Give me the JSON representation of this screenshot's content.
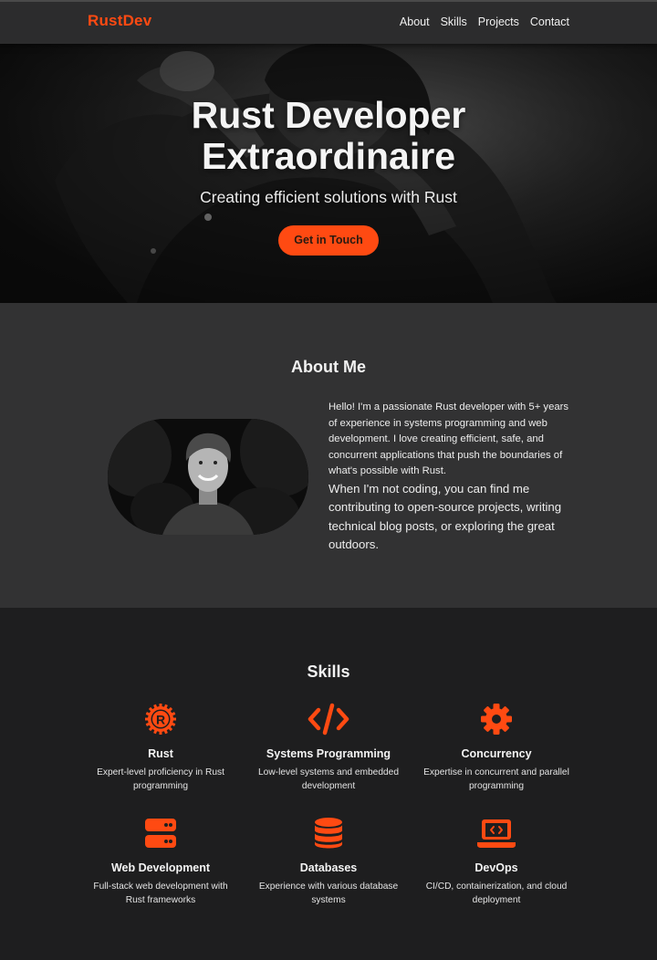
{
  "nav": {
    "brand": "RustDev",
    "links": [
      "About",
      "Skills",
      "Projects",
      "Contact"
    ]
  },
  "hero": {
    "title": "Rust Developer Extraordinaire",
    "subtitle": "Creating efficient solutions with Rust",
    "cta_label": "Get in Touch"
  },
  "about": {
    "title": "About Me",
    "paragraph1": "Hello! I'm a passionate Rust developer with 5+ years of experience in systems programming and web development. I love creating efficient, safe, and concurrent applications that push the boundaries of what's possible with Rust.",
    "paragraph2": "When I'm not coding, you can find me contributing to open-source projects, writing technical blog posts, or exploring the great outdoors."
  },
  "skills": {
    "title": "Skills",
    "items": [
      {
        "name": "Rust",
        "description": "Expert-level proficiency in Rust programming",
        "icon": "rust-logo-icon"
      },
      {
        "name": "Systems Programming",
        "description": "Low-level systems and embedded development",
        "icon": "code-icon"
      },
      {
        "name": "Concurrency",
        "description": "Expertise in concurrent and parallel programming",
        "icon": "gear-icon"
      },
      {
        "name": "Web Development",
        "description": "Full-stack web development with Rust frameworks",
        "icon": "server-icon"
      },
      {
        "name": "Databases",
        "description": "Experience with various database systems",
        "icon": "database-icon"
      },
      {
        "name": "DevOps",
        "description": "CI/CD, containerization, and cloud deployment",
        "icon": "laptop-code-icon"
      }
    ]
  },
  "colors": {
    "accent": "#ff4a12",
    "nav_bg": "#2c2c2d",
    "about_bg": "#323233",
    "skills_bg": "#1e1e1f"
  }
}
